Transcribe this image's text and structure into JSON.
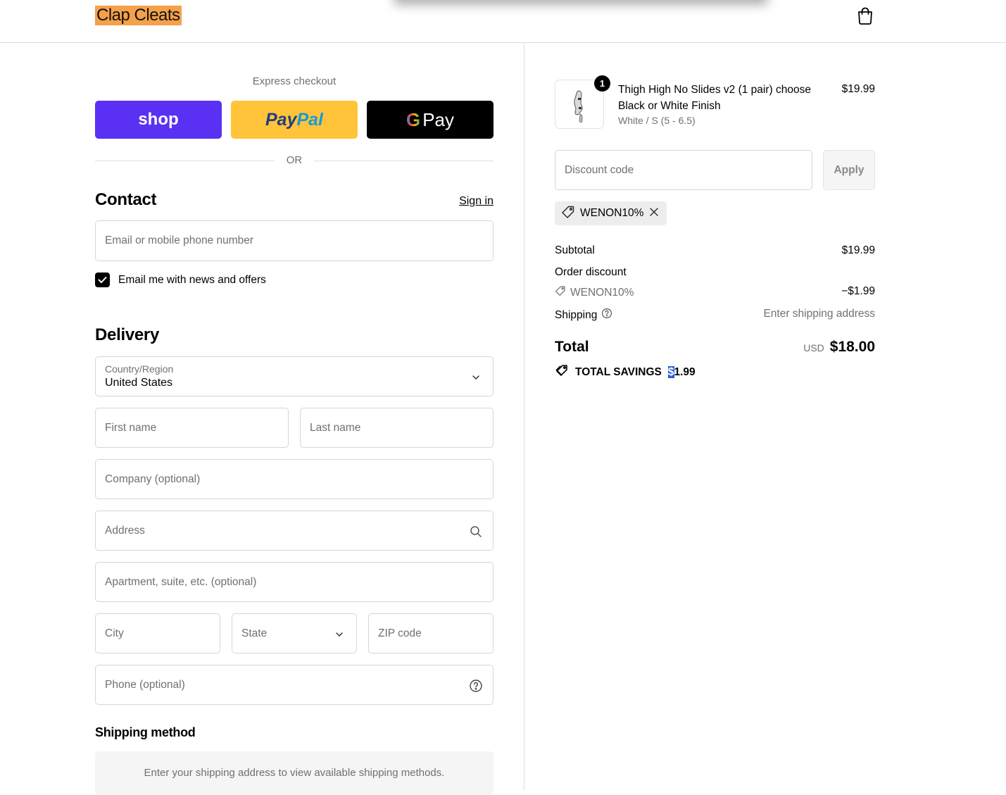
{
  "header": {
    "brand": "Clap Cleats",
    "cart_icon": "shopping-bag-icon"
  },
  "express": {
    "label": "Express checkout",
    "shop_label": "shop",
    "paypal_part1": "Pay",
    "paypal_part2": "Pal",
    "gpay_g": "G",
    "gpay_label": "Pay",
    "or_label": "OR"
  },
  "contact": {
    "title": "Contact",
    "sign_in": "Sign in",
    "email_placeholder": "Email or mobile phone number",
    "newsletter_label": "Email me with news and offers",
    "newsletter_checked": true
  },
  "delivery": {
    "title": "Delivery",
    "country_label": "Country/Region",
    "country_value": "United States",
    "first_name": "First name",
    "last_name": "Last name",
    "company": "Company (optional)",
    "address": "Address",
    "apartment": "Apartment, suite, etc. (optional)",
    "city": "City",
    "state": "State",
    "zip": "ZIP code",
    "phone": "Phone (optional)"
  },
  "shipping_method": {
    "title": "Shipping method",
    "message": "Enter your shipping address to view available shipping methods."
  },
  "summary": {
    "item": {
      "quantity": "1",
      "name": "Thigh High No Slides v2 (1 pair) choose Black or White Finish",
      "variant": "White / S (5 - 6.5)",
      "price": "$19.99"
    },
    "discount_placeholder": "Discount code",
    "apply_label": "Apply",
    "applied_code": "WENON10%",
    "subtotal_label": "Subtotal",
    "subtotal_value": "$19.99",
    "order_discount_label": "Order discount",
    "discount_code": "WENON10%",
    "discount_value": "−$1.99",
    "shipping_label": "Shipping",
    "shipping_value": "Enter shipping address",
    "total_label": "Total",
    "currency": "USD",
    "total_value": "$18.00",
    "savings_label": "TOTAL SAVINGS",
    "savings_sel": "$",
    "savings_value": "1.99"
  },
  "colors": {
    "shop": "#5a31f4",
    "paypal": "#ffc439",
    "gpay": "#000000",
    "brand_highlight": "#f5a14a"
  }
}
